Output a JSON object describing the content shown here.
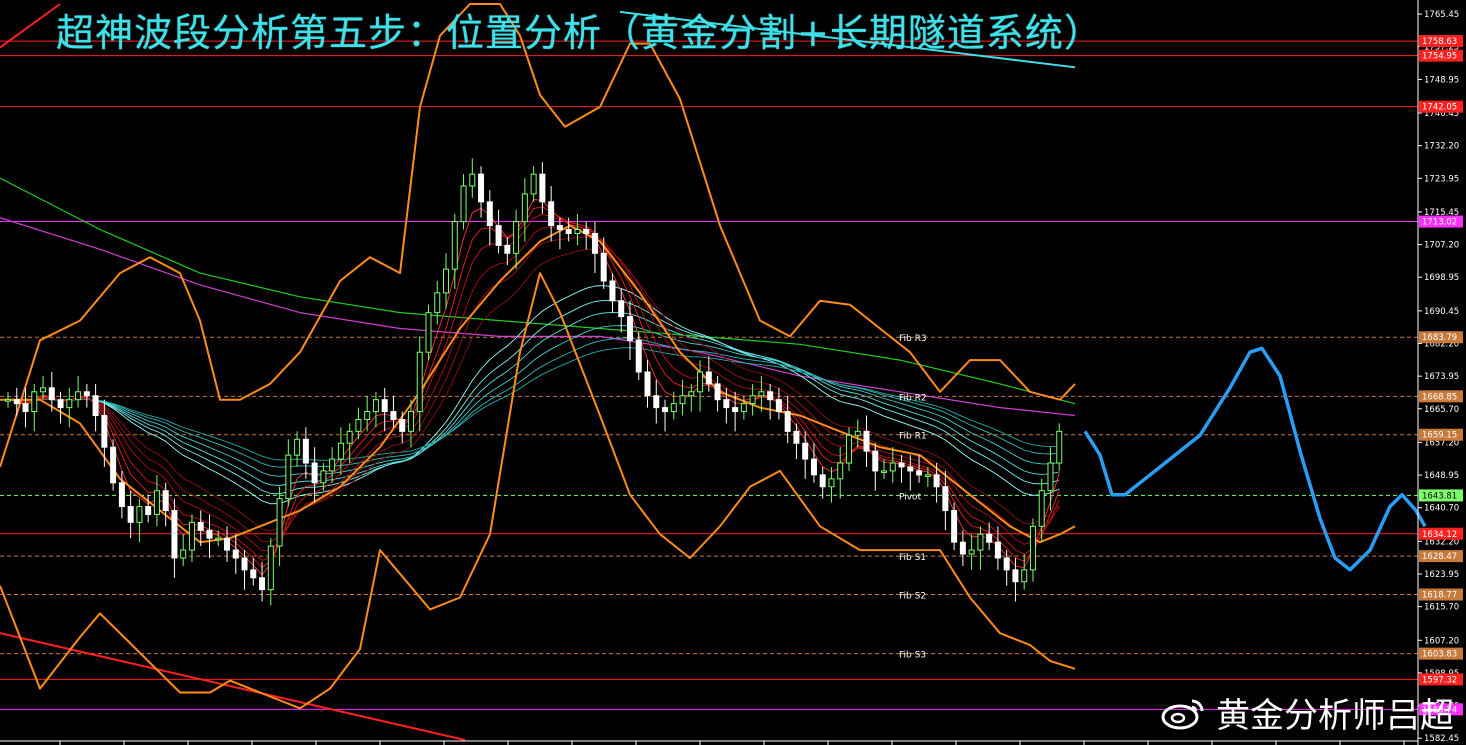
{
  "title": "超神波段分析第五步：位置分析（黄金分割+长期隧道系统）",
  "watermark": "黄金分析师吕超",
  "colors": {
    "background": "#000000",
    "title": "#3fe0e8",
    "bull_candle": "#7cff6b",
    "bear_candle": "#ffffff",
    "bollinger": "#ff8c1a",
    "red_line": "#ff2020",
    "magenta_line": "#ff30ff",
    "pivot_line": "#7cff6b",
    "forecast": "#2a9df4",
    "trend_line": "#3fe0e8",
    "long_ma_green": "#22cc22",
    "long_ma_magenta": "#d040d0"
  },
  "chart_data": {
    "type": "candlestick",
    "title": "超神波段分析第五步：位置分析（黄金分割+长期隧道系统）",
    "ylim": [
      1582.0,
      1768.0
    ],
    "y_ticks": [
      "1765.45",
      "1757.25",
      "1748.95",
      "1740.45",
      "1732.20",
      "1723.95",
      "1715.45",
      "1707.20",
      "1698.95",
      "1690.45",
      "1682.20",
      "1673.95",
      "1665.70",
      "1657.20",
      "1648.95",
      "1640.70",
      "1632.20",
      "1623.95",
      "1615.70",
      "1607.20",
      "1598.95",
      "1590.70",
      "1582.45"
    ],
    "price_tags": [
      {
        "value": 1758.63,
        "label": "1758.63",
        "color": "#ff2020"
      },
      {
        "value": 1754.95,
        "label": "1754.95",
        "color": "#ff2020"
      },
      {
        "value": 1742.05,
        "label": "1742.05",
        "color": "#ff2020"
      },
      {
        "value": 1713.02,
        "label": "1713.02",
        "color": "#ff30ff"
      },
      {
        "value": 1683.79,
        "label": "1683.79",
        "color": "#c87a3a"
      },
      {
        "value": 1668.85,
        "label": "1668.85",
        "color": "#c87a3a"
      },
      {
        "value": 1659.15,
        "label": "1659.15",
        "color": "#c87a3a"
      },
      {
        "value": 1643.81,
        "label": "1643.81",
        "color": "#7cff6b"
      },
      {
        "value": 1634.12,
        "label": "1634.12",
        "color": "#ff2020"
      },
      {
        "value": 1628.47,
        "label": "1628.47",
        "color": "#c87a3a"
      },
      {
        "value": 1618.77,
        "label": "1618.77",
        "color": "#c87a3a"
      },
      {
        "value": 1603.83,
        "label": "1603.83",
        "color": "#c87a3a"
      },
      {
        "value": 1597.32,
        "label": "1597.32",
        "color": "#ff2020"
      },
      {
        "value": 1589.74,
        "label": "1589.74",
        "color": "#ff30ff"
      }
    ],
    "horizontal_lines": [
      {
        "value": 1758.63,
        "style": "solid",
        "color": "#ff2020"
      },
      {
        "value": 1754.95,
        "style": "solid",
        "color": "#ff2020"
      },
      {
        "value": 1742.05,
        "style": "solid",
        "color": "#ff2020"
      },
      {
        "value": 1713.02,
        "style": "solid",
        "color": "#ff30ff"
      },
      {
        "value": 1683.79,
        "style": "dashed",
        "color": "#c87a3a"
      },
      {
        "value": 1668.85,
        "style": "dashed",
        "color": "#c87a3a"
      },
      {
        "value": 1659.15,
        "style": "dashed",
        "color": "#c87a3a"
      },
      {
        "value": 1643.81,
        "style": "dashed",
        "color": "#7cff6b"
      },
      {
        "value": 1634.12,
        "style": "solid",
        "color": "#ff2020"
      },
      {
        "value": 1628.47,
        "style": "dashed",
        "color": "#c87a3a"
      },
      {
        "value": 1618.77,
        "style": "dashed",
        "color": "#c87a3a"
      },
      {
        "value": 1603.83,
        "style": "dashed",
        "color": "#c87a3a"
      },
      {
        "value": 1597.32,
        "style": "solid",
        "color": "#ff2020"
      },
      {
        "value": 1589.74,
        "style": "solid",
        "color": "#ff30ff"
      }
    ],
    "pivot_labels": [
      {
        "text": "Fib R3",
        "value": 1683.79
      },
      {
        "text": "Fib R2",
        "value": 1668.85
      },
      {
        "text": "Fib R1",
        "value": 1659.15
      },
      {
        "text": "Pivot",
        "value": 1643.81
      },
      {
        "text": "Fib S1",
        "value": 1628.47
      },
      {
        "text": "Fib S2",
        "value": 1618.77
      },
      {
        "text": "Fib S3",
        "value": 1603.83
      }
    ],
    "candles_close": [
      1668,
      1667,
      1665,
      1670,
      1671,
      1668,
      1666,
      1668,
      1670,
      1669,
      1664,
      1656,
      1647,
      1641,
      1637,
      1641,
      1639,
      1645,
      1640,
      1628,
      1630,
      1637,
      1635,
      1633,
      1633,
      1630,
      1628,
      1625,
      1623,
      1620,
      1631,
      1643,
      1654,
      1658,
      1652,
      1647,
      1650,
      1653,
      1657,
      1660,
      1663,
      1665,
      1668,
      1665,
      1663,
      1660,
      1665,
      1680,
      1690,
      1695,
      1701,
      1713,
      1722,
      1725,
      1718,
      1712,
      1707,
      1705,
      1713,
      1720,
      1725,
      1718,
      1712,
      1711,
      1710,
      1711,
      1710,
      1705,
      1698,
      1693,
      1689,
      1683,
      1675,
      1669,
      1666,
      1665,
      1667,
      1669,
      1670,
      1675,
      1672,
      1668,
      1666,
      1665,
      1667,
      1669,
      1670,
      1668,
      1665,
      1660,
      1657,
      1653,
      1649,
      1646,
      1648,
      1652,
      1659,
      1660,
      1655,
      1650,
      1650,
      1652,
      1651,
      1650,
      1649,
      1649,
      1646,
      1640,
      1632,
      1629,
      1630,
      1634,
      1632,
      1628,
      1625,
      1622,
      1625,
      1636,
      1645,
      1652,
      1660
    ],
    "bollinger_upper": [
      [
        0,
        1651
      ],
      [
        40,
        1683
      ],
      [
        80,
        1688
      ],
      [
        120,
        1700
      ],
      [
        150,
        1704
      ],
      [
        180,
        1700
      ],
      [
        200,
        1688
      ],
      [
        220,
        1668
      ],
      [
        240,
        1668
      ],
      [
        270,
        1672
      ],
      [
        300,
        1680
      ],
      [
        340,
        1698
      ],
      [
        370,
        1704
      ],
      [
        400,
        1700
      ],
      [
        420,
        1742
      ],
      [
        440,
        1760
      ],
      [
        470,
        1768
      ],
      [
        500,
        1768
      ],
      [
        520,
        1760
      ],
      [
        540,
        1745
      ],
      [
        565,
        1737
      ],
      [
        600,
        1742
      ],
      [
        630,
        1758
      ],
      [
        650,
        1758
      ],
      [
        680,
        1744
      ],
      [
        700,
        1728
      ],
      [
        720,
        1712
      ],
      [
        740,
        1700
      ],
      [
        760,
        1688
      ],
      [
        790,
        1684
      ],
      [
        820,
        1693
      ],
      [
        850,
        1692
      ],
      [
        880,
        1686
      ],
      [
        910,
        1680
      ],
      [
        940,
        1670
      ],
      [
        970,
        1678
      ],
      [
        1000,
        1678
      ],
      [
        1030,
        1670
      ],
      [
        1060,
        1668
      ],
      [
        1075,
        1672
      ]
    ],
    "bollinger_lower": [
      [
        0,
        1621
      ],
      [
        40,
        1595
      ],
      [
        80,
        1608
      ],
      [
        100,
        1614
      ],
      [
        140,
        1604
      ],
      [
        180,
        1594
      ],
      [
        210,
        1594
      ],
      [
        230,
        1597
      ],
      [
        260,
        1594
      ],
      [
        300,
        1590
      ],
      [
        330,
        1595
      ],
      [
        360,
        1605
      ],
      [
        380,
        1630
      ],
      [
        400,
        1624
      ],
      [
        430,
        1615
      ],
      [
        460,
        1618
      ],
      [
        490,
        1634
      ],
      [
        520,
        1680
      ],
      [
        540,
        1700
      ],
      [
        560,
        1690
      ],
      [
        600,
        1664
      ],
      [
        630,
        1644
      ],
      [
        660,
        1634
      ],
      [
        690,
        1628
      ],
      [
        720,
        1636
      ],
      [
        750,
        1646
      ],
      [
        780,
        1650
      ],
      [
        820,
        1636
      ],
      [
        860,
        1630
      ],
      [
        900,
        1630
      ],
      [
        940,
        1630
      ],
      [
        970,
        1618
      ],
      [
        1000,
        1609
      ],
      [
        1030,
        1606
      ],
      [
        1050,
        1602
      ],
      [
        1075,
        1600
      ]
    ],
    "bollinger_mid": [
      [
        0,
        1668
      ],
      [
        40,
        1668
      ],
      [
        80,
        1662
      ],
      [
        120,
        1648
      ],
      [
        160,
        1640
      ],
      [
        200,
        1632
      ],
      [
        230,
        1633
      ],
      [
        260,
        1636
      ],
      [
        300,
        1640
      ],
      [
        340,
        1646
      ],
      [
        380,
        1656
      ],
      [
        420,
        1670
      ],
      [
        460,
        1686
      ],
      [
        500,
        1698
      ],
      [
        540,
        1708
      ],
      [
        570,
        1712
      ],
      [
        600,
        1708
      ],
      [
        640,
        1695
      ],
      [
        680,
        1680
      ],
      [
        720,
        1670
      ],
      [
        760,
        1666
      ],
      [
        800,
        1664
      ],
      [
        840,
        1660
      ],
      [
        880,
        1656
      ],
      [
        920,
        1654
      ],
      [
        950,
        1648
      ],
      [
        980,
        1642
      ],
      [
        1010,
        1636
      ],
      [
        1040,
        1632
      ],
      [
        1060,
        1634
      ],
      [
        1075,
        1636
      ]
    ],
    "long_ma_green": [
      [
        0,
        1724
      ],
      [
        100,
        1711
      ],
      [
        200,
        1700
      ],
      [
        300,
        1694
      ],
      [
        400,
        1690
      ],
      [
        500,
        1688
      ],
      [
        600,
        1686
      ],
      [
        700,
        1684
      ],
      [
        800,
        1682
      ],
      [
        900,
        1678
      ],
      [
        1000,
        1672
      ],
      [
        1075,
        1667
      ]
    ],
    "long_ma_magenta": [
      [
        0,
        1714
      ],
      [
        100,
        1706
      ],
      [
        200,
        1697
      ],
      [
        300,
        1690
      ],
      [
        400,
        1686
      ],
      [
        500,
        1684
      ],
      [
        600,
        1684
      ],
      [
        700,
        1680
      ],
      [
        800,
        1674
      ],
      [
        900,
        1670
      ],
      [
        1000,
        1666
      ],
      [
        1075,
        1664
      ]
    ],
    "forecast_path": [
      [
        1085,
        1660
      ],
      [
        1100,
        1654
      ],
      [
        1112,
        1644
      ],
      [
        1125,
        1644
      ],
      [
        1160,
        1651
      ],
      [
        1200,
        1659
      ],
      [
        1230,
        1671
      ],
      [
        1250,
        1680
      ],
      [
        1262,
        1681
      ],
      [
        1280,
        1674
      ],
      [
        1300,
        1655
      ],
      [
        1320,
        1638
      ],
      [
        1335,
        1628
      ],
      [
        1350,
        1625
      ],
      [
        1370,
        1630
      ],
      [
        1390,
        1641
      ],
      [
        1402,
        1644
      ],
      [
        1416,
        1640
      ],
      [
        1425,
        1636
      ]
    ],
    "trend_lines": [
      {
        "color": "#3fe0e8",
        "from": [
          620,
          1766
        ],
        "to": [
          1075,
          1752
        ]
      },
      {
        "color": "#ff2020",
        "from": [
          0,
          1757
        ],
        "to": [
          60,
          1768
        ]
      },
      {
        "color": "#ff2020",
        "from": [
          0,
          1609
        ],
        "to": [
          465,
          1582
        ]
      }
    ]
  }
}
